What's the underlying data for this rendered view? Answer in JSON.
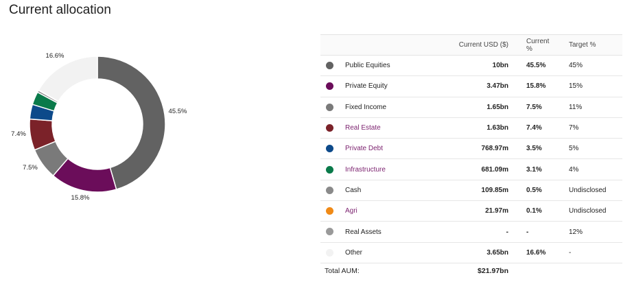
{
  "title": "Current allocation",
  "chart_data": {
    "type": "pie",
    "variant": "donut",
    "slices": [
      {
        "name": "Public Equities",
        "value": 45.5,
        "color": "#626262",
        "label": "45.5%"
      },
      {
        "name": "Private Equity",
        "value": 15.8,
        "color": "#6b0d5a",
        "label": "15.8%"
      },
      {
        "name": "Fixed Income",
        "value": 7.5,
        "color": "#7a7a7a",
        "label": "7.5%"
      },
      {
        "name": "Real Estate",
        "value": 7.4,
        "color": "#7b2229",
        "label": "7.4%"
      },
      {
        "name": "Private Debt",
        "value": 3.5,
        "color": "#0d4a8a",
        "label": ""
      },
      {
        "name": "Infrastructure",
        "value": 3.1,
        "color": "#0a7a4a",
        "label": ""
      },
      {
        "name": "Cash",
        "value": 0.5,
        "color": "#8a8a8a",
        "label": ""
      },
      {
        "name": "Agri",
        "value": 0.1,
        "color": "#f08a17",
        "label": ""
      },
      {
        "name": "Real Assets",
        "value": 0,
        "color": "#9a9a9a",
        "label": ""
      },
      {
        "name": "Other",
        "value": 16.6,
        "color": "#f2f2f2",
        "label": "16.6%"
      }
    ]
  },
  "table": {
    "headers": {
      "usd": "Current USD ($)",
      "pct": "Current %",
      "target": "Target %"
    },
    "rows": [
      {
        "name": "Public Equities",
        "color": "#626262",
        "usd": "10bn",
        "pct": "45.5%",
        "target": "45%",
        "link": false
      },
      {
        "name": "Private Equity",
        "color": "#6b0d5a",
        "usd": "3.47bn",
        "pct": "15.8%",
        "target": "15%",
        "link": false
      },
      {
        "name": "Fixed Income",
        "color": "#7a7a7a",
        "usd": "1.65bn",
        "pct": "7.5%",
        "target": "11%",
        "link": false
      },
      {
        "name": "Real Estate",
        "color": "#7b2229",
        "usd": "1.63bn",
        "pct": "7.4%",
        "target": "7%",
        "link": true
      },
      {
        "name": "Private Debt",
        "color": "#0d4a8a",
        "usd": "768.97m",
        "pct": "3.5%",
        "target": "5%",
        "link": true
      },
      {
        "name": "Infrastructure",
        "color": "#0a7a4a",
        "usd": "681.09m",
        "pct": "3.1%",
        "target": "4%",
        "link": true
      },
      {
        "name": "Cash",
        "color": "#8a8a8a",
        "usd": "109.85m",
        "pct": "0.5%",
        "target": "Undisclosed",
        "link": false
      },
      {
        "name": "Agri",
        "color": "#f08a17",
        "usd": "21.97m",
        "pct": "0.1%",
        "target": "Undisclosed",
        "link": true
      },
      {
        "name": "Real Assets",
        "color": "#9a9a9a",
        "usd": "-",
        "pct": "-",
        "target": "12%",
        "link": false
      },
      {
        "name": "Other",
        "color": "#f2f2f2",
        "usd": "3.65bn",
        "pct": "16.6%",
        "target": "-",
        "link": false
      }
    ],
    "total_label": "Total AUM:",
    "total_value": "$21.97bn"
  }
}
